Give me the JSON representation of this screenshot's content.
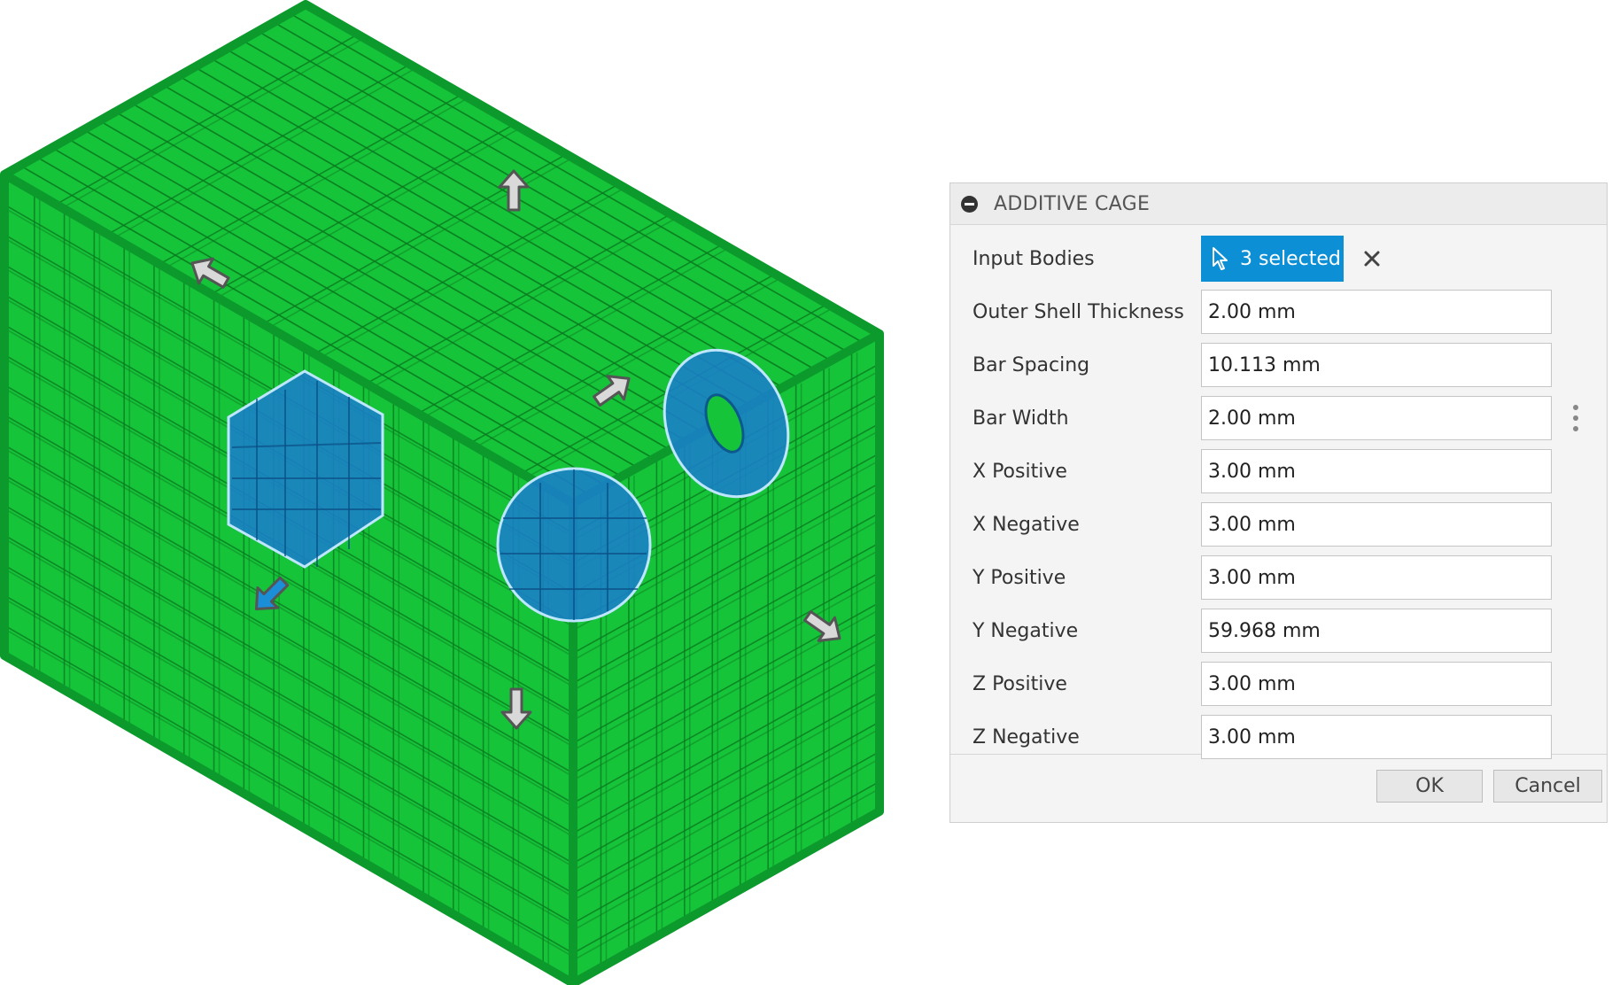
{
  "viewport": {
    "model": "additive-cage-lattice",
    "colors": {
      "cage": "#16c43a",
      "cage_dark": "#0a7a1f",
      "bodies": "#1a7ed0",
      "arrow": "#d9d9d9",
      "arrow_active": "#1a8fd8"
    }
  },
  "dialog": {
    "title": "ADDITIVE CAGE",
    "input_bodies": {
      "label": "Input Bodies",
      "value": "3 selected"
    },
    "fields": [
      {
        "label": "Outer Shell Thickness",
        "value": "2.00 mm"
      },
      {
        "label": "Bar Spacing",
        "value": "10.113 mm"
      },
      {
        "label": "Bar Width",
        "value": "2.00 mm"
      },
      {
        "label": "X Positive",
        "value": "3.00 mm"
      },
      {
        "label": "X Negative",
        "value": "3.00 mm"
      },
      {
        "label": "Y Positive",
        "value": "3.00 mm"
      },
      {
        "label": "Y Negative",
        "value": "59.968 mm"
      },
      {
        "label": "Z Positive",
        "value": "3.00 mm"
      },
      {
        "label": "Z Negative",
        "value": "3.00 mm"
      }
    ],
    "ok_label": "OK",
    "cancel_label": "Cancel",
    "colors": {
      "accent": "#0d8fd6"
    }
  }
}
